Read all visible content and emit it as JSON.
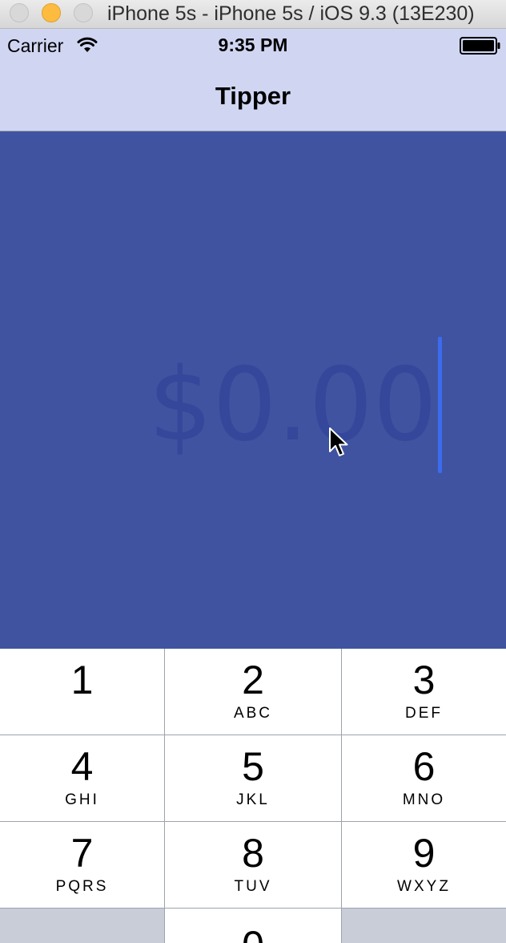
{
  "window": {
    "title": "iPhone 5s - iPhone 5s / iOS 9.3 (13E230)"
  },
  "status_bar": {
    "carrier": "Carrier",
    "time": "9:35 PM",
    "wifi_icon": "wifi-icon",
    "battery_icon": "battery-icon"
  },
  "nav": {
    "title": "Tipper"
  },
  "bill": {
    "value": "",
    "placeholder": "$0.00"
  },
  "colors": {
    "nav_background": "#d0d6f2",
    "main_background": "#3f53a0",
    "placeholder_text": "#34479a",
    "caret": "#3d6bef",
    "keypad_key": "#ffffff",
    "keypad_separator": "#9da3ad"
  },
  "keypad": {
    "keys": [
      {
        "digit": "1",
        "letters": ""
      },
      {
        "digit": "2",
        "letters": "ABC"
      },
      {
        "digit": "3",
        "letters": "DEF"
      },
      {
        "digit": "4",
        "letters": "GHI"
      },
      {
        "digit": "5",
        "letters": "JKL"
      },
      {
        "digit": "6",
        "letters": "MNO"
      },
      {
        "digit": "7",
        "letters": "PQRS"
      },
      {
        "digit": "8",
        "letters": "TUV"
      },
      {
        "digit": "9",
        "letters": "WXYZ"
      },
      {
        "digit": "0",
        "letters": ""
      }
    ]
  }
}
